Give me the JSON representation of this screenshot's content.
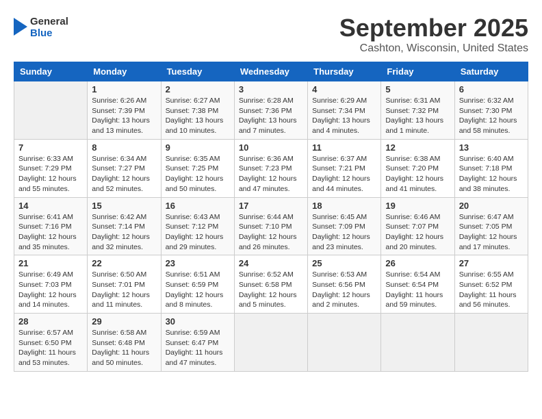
{
  "logo": {
    "line1": "General",
    "line2": "Blue"
  },
  "title": "September 2025",
  "location": "Cashton, Wisconsin, United States",
  "days_of_week": [
    "Sunday",
    "Monday",
    "Tuesday",
    "Wednesday",
    "Thursday",
    "Friday",
    "Saturday"
  ],
  "weeks": [
    [
      {
        "day": "",
        "info": ""
      },
      {
        "day": "1",
        "info": "Sunrise: 6:26 AM\nSunset: 7:39 PM\nDaylight: 13 hours\nand 13 minutes."
      },
      {
        "day": "2",
        "info": "Sunrise: 6:27 AM\nSunset: 7:38 PM\nDaylight: 13 hours\nand 10 minutes."
      },
      {
        "day": "3",
        "info": "Sunrise: 6:28 AM\nSunset: 7:36 PM\nDaylight: 13 hours\nand 7 minutes."
      },
      {
        "day": "4",
        "info": "Sunrise: 6:29 AM\nSunset: 7:34 PM\nDaylight: 13 hours\nand 4 minutes."
      },
      {
        "day": "5",
        "info": "Sunrise: 6:31 AM\nSunset: 7:32 PM\nDaylight: 13 hours\nand 1 minute."
      },
      {
        "day": "6",
        "info": "Sunrise: 6:32 AM\nSunset: 7:30 PM\nDaylight: 12 hours\nand 58 minutes."
      }
    ],
    [
      {
        "day": "7",
        "info": "Sunrise: 6:33 AM\nSunset: 7:29 PM\nDaylight: 12 hours\nand 55 minutes."
      },
      {
        "day": "8",
        "info": "Sunrise: 6:34 AM\nSunset: 7:27 PM\nDaylight: 12 hours\nand 52 minutes."
      },
      {
        "day": "9",
        "info": "Sunrise: 6:35 AM\nSunset: 7:25 PM\nDaylight: 12 hours\nand 50 minutes."
      },
      {
        "day": "10",
        "info": "Sunrise: 6:36 AM\nSunset: 7:23 PM\nDaylight: 12 hours\nand 47 minutes."
      },
      {
        "day": "11",
        "info": "Sunrise: 6:37 AM\nSunset: 7:21 PM\nDaylight: 12 hours\nand 44 minutes."
      },
      {
        "day": "12",
        "info": "Sunrise: 6:38 AM\nSunset: 7:20 PM\nDaylight: 12 hours\nand 41 minutes."
      },
      {
        "day": "13",
        "info": "Sunrise: 6:40 AM\nSunset: 7:18 PM\nDaylight: 12 hours\nand 38 minutes."
      }
    ],
    [
      {
        "day": "14",
        "info": "Sunrise: 6:41 AM\nSunset: 7:16 PM\nDaylight: 12 hours\nand 35 minutes."
      },
      {
        "day": "15",
        "info": "Sunrise: 6:42 AM\nSunset: 7:14 PM\nDaylight: 12 hours\nand 32 minutes."
      },
      {
        "day": "16",
        "info": "Sunrise: 6:43 AM\nSunset: 7:12 PM\nDaylight: 12 hours\nand 29 minutes."
      },
      {
        "day": "17",
        "info": "Sunrise: 6:44 AM\nSunset: 7:10 PM\nDaylight: 12 hours\nand 26 minutes."
      },
      {
        "day": "18",
        "info": "Sunrise: 6:45 AM\nSunset: 7:09 PM\nDaylight: 12 hours\nand 23 minutes."
      },
      {
        "day": "19",
        "info": "Sunrise: 6:46 AM\nSunset: 7:07 PM\nDaylight: 12 hours\nand 20 minutes."
      },
      {
        "day": "20",
        "info": "Sunrise: 6:47 AM\nSunset: 7:05 PM\nDaylight: 12 hours\nand 17 minutes."
      }
    ],
    [
      {
        "day": "21",
        "info": "Sunrise: 6:49 AM\nSunset: 7:03 PM\nDaylight: 12 hours\nand 14 minutes."
      },
      {
        "day": "22",
        "info": "Sunrise: 6:50 AM\nSunset: 7:01 PM\nDaylight: 12 hours\nand 11 minutes."
      },
      {
        "day": "23",
        "info": "Sunrise: 6:51 AM\nSunset: 6:59 PM\nDaylight: 12 hours\nand 8 minutes."
      },
      {
        "day": "24",
        "info": "Sunrise: 6:52 AM\nSunset: 6:58 PM\nDaylight: 12 hours\nand 5 minutes."
      },
      {
        "day": "25",
        "info": "Sunrise: 6:53 AM\nSunset: 6:56 PM\nDaylight: 12 hours\nand 2 minutes."
      },
      {
        "day": "26",
        "info": "Sunrise: 6:54 AM\nSunset: 6:54 PM\nDaylight: 11 hours\nand 59 minutes."
      },
      {
        "day": "27",
        "info": "Sunrise: 6:55 AM\nSunset: 6:52 PM\nDaylight: 11 hours\nand 56 minutes."
      }
    ],
    [
      {
        "day": "28",
        "info": "Sunrise: 6:57 AM\nSunset: 6:50 PM\nDaylight: 11 hours\nand 53 minutes."
      },
      {
        "day": "29",
        "info": "Sunrise: 6:58 AM\nSunset: 6:48 PM\nDaylight: 11 hours\nand 50 minutes."
      },
      {
        "day": "30",
        "info": "Sunrise: 6:59 AM\nSunset: 6:47 PM\nDaylight: 11 hours\nand 47 minutes."
      },
      {
        "day": "",
        "info": ""
      },
      {
        "day": "",
        "info": ""
      },
      {
        "day": "",
        "info": ""
      },
      {
        "day": "",
        "info": ""
      }
    ]
  ]
}
